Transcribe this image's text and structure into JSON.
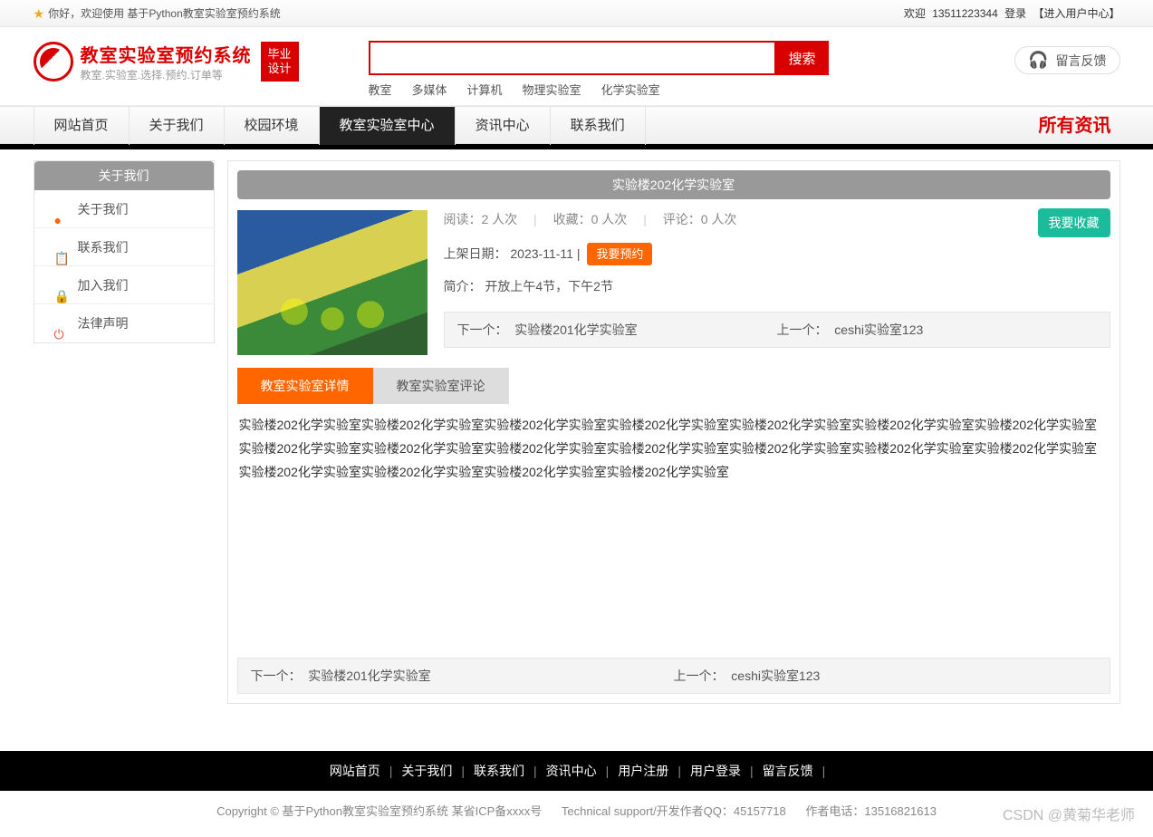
{
  "topbar": {
    "greeting": "你好，欢迎使用 基于Python教室实验室预约系统",
    "welcome": "欢迎",
    "phone": "13511223344",
    "login": "登录",
    "usercenter": "【进入用户中心】"
  },
  "logo": {
    "title": "教室实验室预约系统",
    "subtitle": "教室.实验室.选择.预约.订单等",
    "badge": "毕业\n设计"
  },
  "search": {
    "btn": "搜索",
    "links": [
      "教室",
      "多媒体",
      "计算机",
      "物理实验室",
      "化学实验室"
    ]
  },
  "feedback": {
    "label": "留言反馈"
  },
  "nav": {
    "items": [
      "网站首页",
      "关于我们",
      "校园环境",
      "教室实验室中心",
      "资讯中心",
      "联系我们"
    ],
    "active_index": 3,
    "right": "所有资讯"
  },
  "sidebar": {
    "title": "关于我们",
    "items": [
      {
        "icon": "info-icon",
        "color": "c-orange",
        "glyph": "●",
        "label": "关于我们"
      },
      {
        "icon": "contact-icon",
        "color": "c-blue",
        "glyph": "📋",
        "label": "联系我们"
      },
      {
        "icon": "join-icon",
        "color": "c-red",
        "glyph": "🔒",
        "label": "加入我们"
      },
      {
        "icon": "legal-icon",
        "color": "c-red",
        "glyph": "⏻",
        "label": "法律声明"
      }
    ]
  },
  "page": {
    "title": "实验楼202化学实验室",
    "stats": {
      "read_label": "阅读：",
      "read_val": "2 人次",
      "fav_label": "收藏：",
      "fav_val": "0 人次",
      "comment_label": "评论：",
      "comment_val": "0 人次"
    },
    "fav_btn": "我要收藏",
    "date_label": "上架日期：",
    "date_val": "2023-11-11",
    "book_btn": "我要预约",
    "intro_label": "简介：",
    "intro_val": "开放上午4节，下午2节",
    "nav_prev_label": "下一个：",
    "nav_prev_val": "实验楼201化学实验室",
    "nav_next_label": "上一个：",
    "nav_next_val": "ceshi实验室123",
    "tabs": [
      "教室实验室详情",
      "教室实验室评论"
    ],
    "tab_active": 0,
    "description": "实验楼202化学实验室实验楼202化学实验室实验楼202化学实验室实验楼202化学实验室实验楼202化学实验室实验楼202化学实验室实验楼202化学实验室实验楼202化学实验室实验楼202化学实验室实验楼202化学实验室实验楼202化学实验室实验楼202化学实验室实验楼202化学实验室实验楼202化学实验室实验楼202化学实验室实验楼202化学实验室实验楼202化学实验室实验楼202化学实验室"
  },
  "footer": {
    "links": [
      "网站首页",
      "关于我们",
      "联系我们",
      "资讯中心",
      "用户注册",
      "用户登录",
      "留言反馈"
    ],
    "copyright": "Copyright © 基于Python教室实验室预约系统 某省ICP备xxxx号",
    "tech": "Technical support/开发作者QQ：45157718",
    "author_tel": "作者电话：13516821613"
  },
  "watermark": "CSDN @黄菊华老师"
}
